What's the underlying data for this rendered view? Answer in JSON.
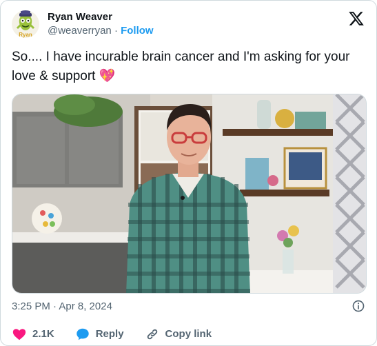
{
  "user": {
    "display_name": "Ryan Weaver",
    "handle": "@weaverryan",
    "separator": "·",
    "follow_label": "Follow",
    "avatar_text": "Ryan"
  },
  "tweet": {
    "text": "So.... I have incurable brain cancer and I'm asking for your love & support",
    "emoji": "💖"
  },
  "timestamp": "3:25 PM · Apr 8, 2024",
  "actions": {
    "likes": "2.1K",
    "reply_label": "Reply",
    "copy_link_label": "Copy link"
  },
  "colors": {
    "accent": "#1d9bf0",
    "like": "#f91880",
    "reply": "#1d9bf0",
    "muted": "#536471"
  },
  "icons": {
    "brand": "x-logo-icon",
    "info": "info-icon",
    "like": "heart-icon",
    "reply": "speech-bubble-icon",
    "copy_link": "link-icon"
  }
}
